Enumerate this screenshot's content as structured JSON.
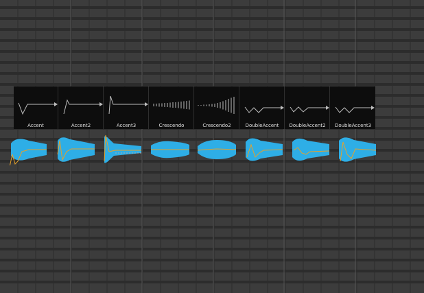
{
  "presets": [
    {
      "label": "Accent",
      "icon": "accent-envelope-icon"
    },
    {
      "label": "Accent2",
      "icon": "accent2-envelope-icon"
    },
    {
      "label": "Accent3",
      "icon": "accent3-envelope-icon"
    },
    {
      "label": "Crescendo",
      "icon": "crescendo-envelope-icon"
    },
    {
      "label": "Crescendo2",
      "icon": "crescendo2-envelope-icon"
    },
    {
      "label": "DoubleAccent",
      "icon": "doubleaccent-envelope-icon"
    },
    {
      "label": "DoubleAccent2",
      "icon": "doubleaccent2-envelope-icon"
    },
    {
      "label": "DoubleAccent3",
      "icon": "doubleaccent3-envelope-icon"
    }
  ],
  "colors": {
    "background": "#3c3c3c",
    "grid_line": "#2c2c2c",
    "grid_major": "#555555",
    "tile_bg": "#0d0d0d",
    "waveform": "#2eaee6",
    "envelope_curve": "#e6a12a"
  }
}
